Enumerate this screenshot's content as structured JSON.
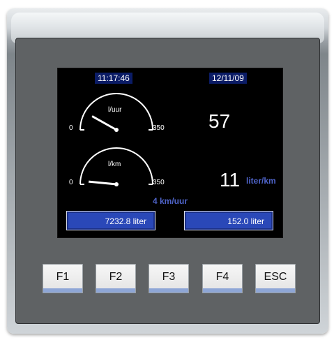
{
  "screen": {
    "time": "11:17:46",
    "date": "12/11/09",
    "gauge1": {
      "unit": "l/uur",
      "min": "0",
      "max": "350",
      "value": 57
    },
    "gauge2": {
      "unit": "l/km",
      "min": "0",
      "max": "350",
      "value": 11
    },
    "readout1": "57",
    "readout2": "11",
    "readout2_unit": "liter/km",
    "speed": "4 km/uur",
    "box_left": "7232.8 liter",
    "box_right": "152.0 liter"
  },
  "keys": [
    {
      "label": "F1"
    },
    {
      "label": "F2"
    },
    {
      "label": "F3"
    },
    {
      "label": "F4"
    },
    {
      "label": "ESC"
    }
  ],
  "colors": {
    "screen_bg": "#000000",
    "accent_blue": "#2a48b8",
    "text_blue": "#4e63c8"
  }
}
